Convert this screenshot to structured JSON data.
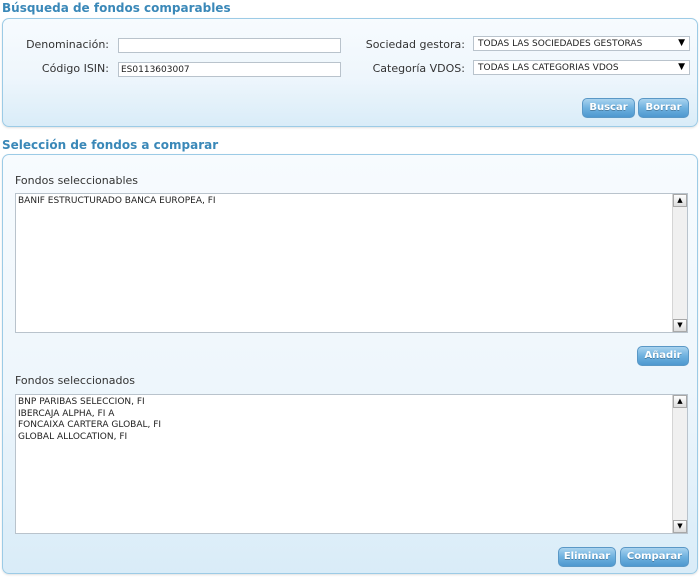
{
  "search": {
    "title": "Búsqueda de fondos comparables",
    "denominacion_label": "Denominación:",
    "denominacion_value": "",
    "isin_label": "Código ISIN:",
    "isin_value": "ES0113603007",
    "sociedad_label": "Sociedad gestora:",
    "sociedad_value": "TODAS LAS SOCIEDADES GESTORAS",
    "categoria_label": "Categoría VDOS:",
    "categoria_value": "TODAS LAS CATEGORIAS VDOS",
    "buscar_label": "Buscar",
    "borrar_label": "Borrar"
  },
  "selection": {
    "title": "Selección de fondos a comparar",
    "available_label": "Fondos seleccionables",
    "available_items": [
      "BANIF ESTRUCTURADO BANCA EUROPEA, FI"
    ],
    "add_label": "Añadir",
    "selected_label": "Fondos seleccionados",
    "selected_items": [
      "BNP PARIBAS SELECCION, FI",
      "IBERCAJA ALPHA, FI A",
      "FONCAIXA CARTERA GLOBAL, FI",
      "GLOBAL ALLOCATION, FI"
    ],
    "remove_label": "Eliminar",
    "compare_label": "Comparar"
  },
  "icons": {
    "dropdown_arrow": "▼",
    "scroll_up": "▲",
    "scroll_down": "▼"
  },
  "colors": {
    "title_blue": "#3a88b8",
    "panel_border": "#9ccbe6",
    "button_blue": "#6eb1df"
  }
}
